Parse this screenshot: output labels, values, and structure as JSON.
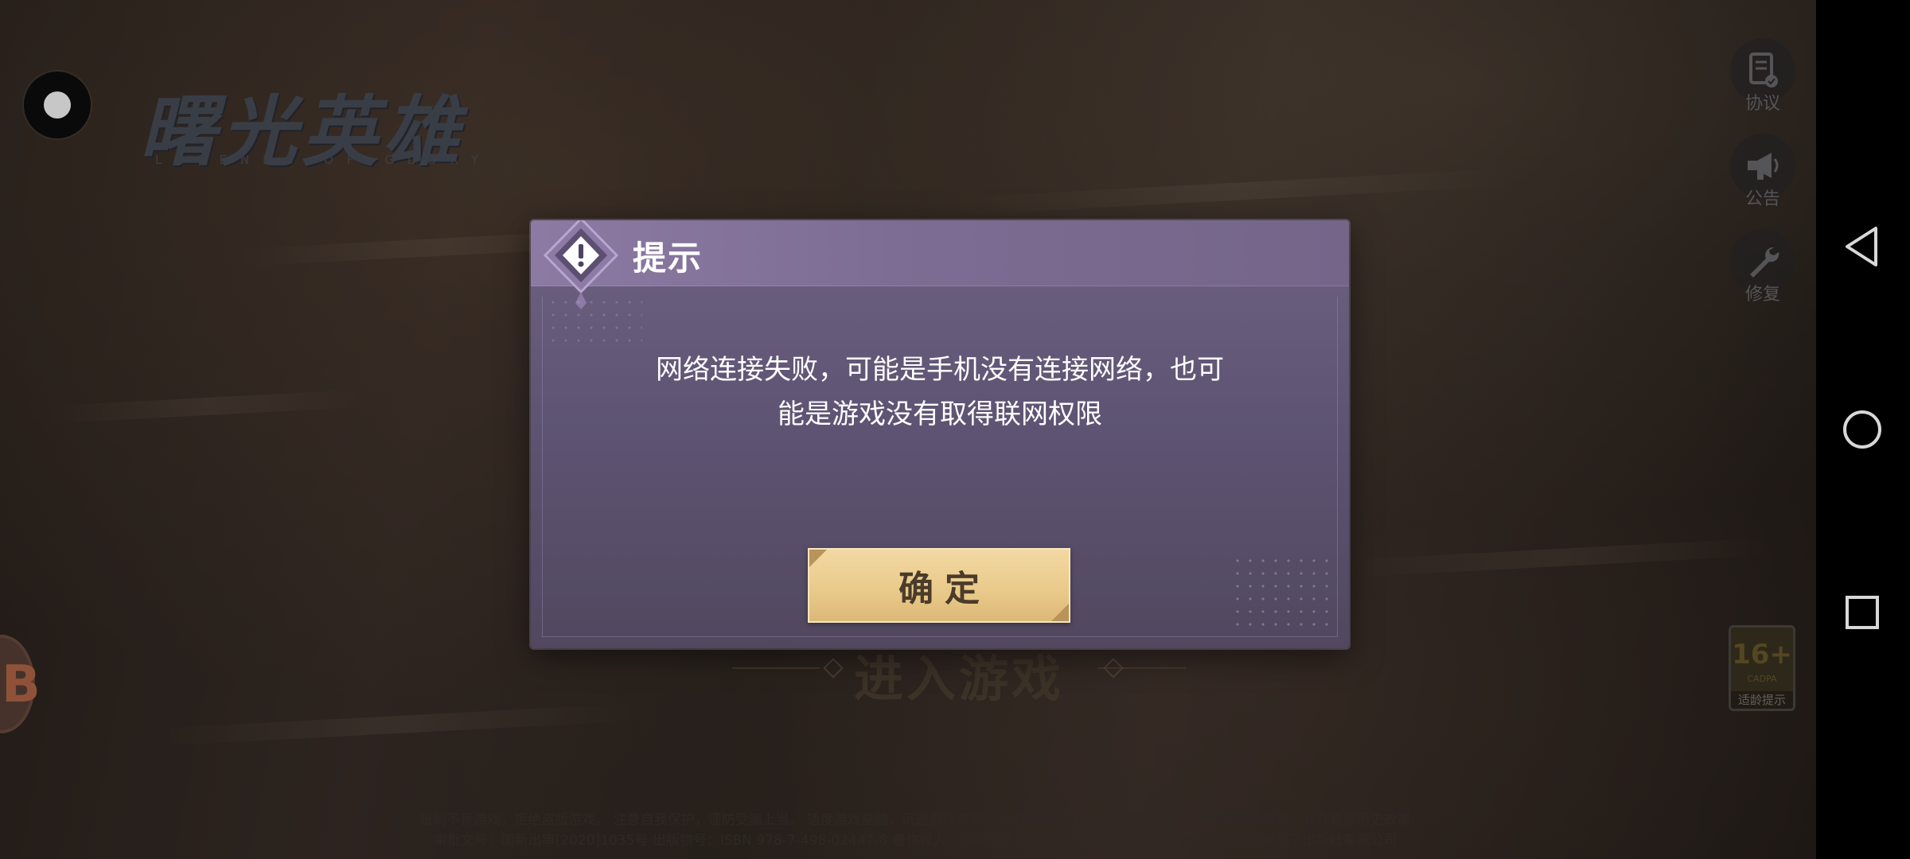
{
  "game": {
    "logo_text": "曙光英雄",
    "logo_subtitle": "LEGENDS OF GLORY",
    "enter_game_label": "进入游戏",
    "side_tools": [
      {
        "label": "协议",
        "icon": "document-check-icon"
      },
      {
        "label": "公告",
        "icon": "megaphone-icon"
      },
      {
        "label": "修复",
        "icon": "wrench-icon"
      }
    ],
    "age_rating": {
      "number": "16+",
      "word": "CADPA",
      "caption": "适龄提示"
    },
    "footer": {
      "line1": "抵制不良游戏，拒绝盗版游戏。 注意自我保护，谨防受骗上当。 适度游戏益脑，沉迷游戏伤身。 合理安排时间，享受健康生活。 本故事纯属虚构，并非真实历史故事",
      "line2": "审批文号：国新出审[2020]1035号 出版物号：ISBN 978-7-498-02447-8 著作权人：游戏世界（成都）网络技术有限公司 出版单位：天津电子出版社有限公司"
    }
  },
  "dialog": {
    "title": "提示",
    "message_line1": "网络连接失败，可能是手机没有连接网络，也可",
    "message_line2": "能是游戏没有取得联网权限",
    "confirm_label": "确定"
  },
  "nav_bar": {
    "buttons": [
      "back",
      "home",
      "recents"
    ]
  },
  "colors": {
    "dialog_header": "#8c7aa3",
    "dialog_body": "#5f5474",
    "confirm_button": "#e9c989",
    "nav_bar": "#000000"
  }
}
